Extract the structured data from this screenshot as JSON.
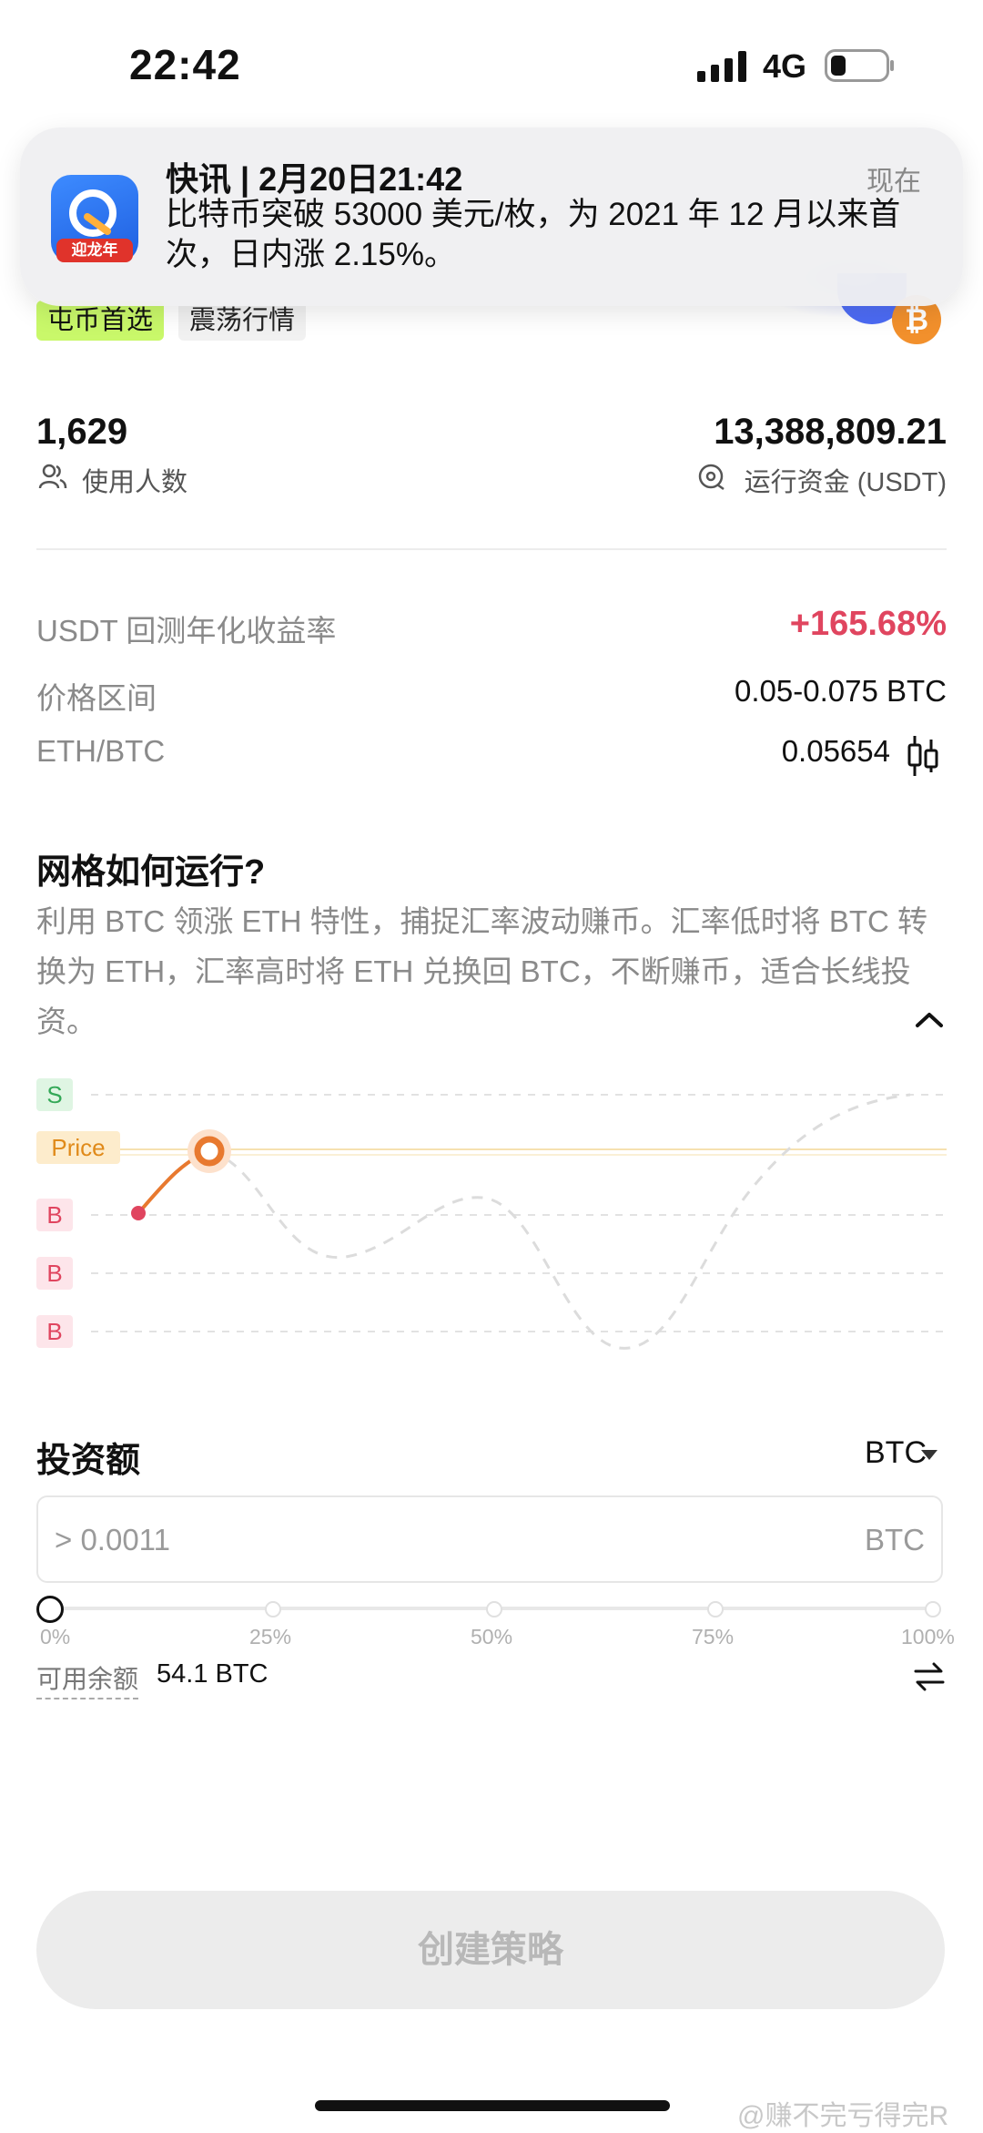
{
  "status_bar": {
    "time": "22:42",
    "network": "4G"
  },
  "notification": {
    "app_badge": "迎龙年",
    "title": "快讯 | 2月20日21:42",
    "time": "现在",
    "body": "比特币突破 53000 美元/枚，为 2021 年 12 月以来首次，日内涨 2.15%。"
  },
  "tags": [
    "屯币首选",
    "震荡行情"
  ],
  "coin_icon": "₿",
  "stats": {
    "users_count": "1,629",
    "users_label": "使用人数",
    "funds_value": "13,388,809.21",
    "funds_label": "运行资金 (USDT)"
  },
  "metrics": [
    {
      "label": "USDT 回测年化收益率",
      "value": "+165.68%"
    },
    {
      "label": "价格区间",
      "value": "0.05-0.075 BTC"
    },
    {
      "label": "ETH/BTC",
      "value": "0.05654"
    }
  ],
  "how_it_works": {
    "title": "网格如何运行?",
    "description": "利用 BTC 领涨 ETH 特性，捕捉汇率波动赚币。汇率低时将 BTC 转换为 ETH，汇率高时将 ETH 兑换回 BTC，不断赚币，适合长线投资。"
  },
  "grid_chart": {
    "levels": [
      "S",
      "Price",
      "B",
      "B",
      "B"
    ]
  },
  "investment": {
    "title": "投资额",
    "currency": "BTC",
    "placeholder": "> 0.0011",
    "unit": "BTC",
    "slider_labels": [
      "0%",
      "25%",
      "50%",
      "75%",
      "100%"
    ],
    "slider_value": 0,
    "available_label": "可用余额",
    "available_value": "54.1 BTC"
  },
  "create_button": "创建策略",
  "watermark": "@赚不完亏得完R",
  "colors": {
    "positive": "#e0455f",
    "tag_green": "#c9f86a",
    "chart_orange": "#e8792f"
  }
}
